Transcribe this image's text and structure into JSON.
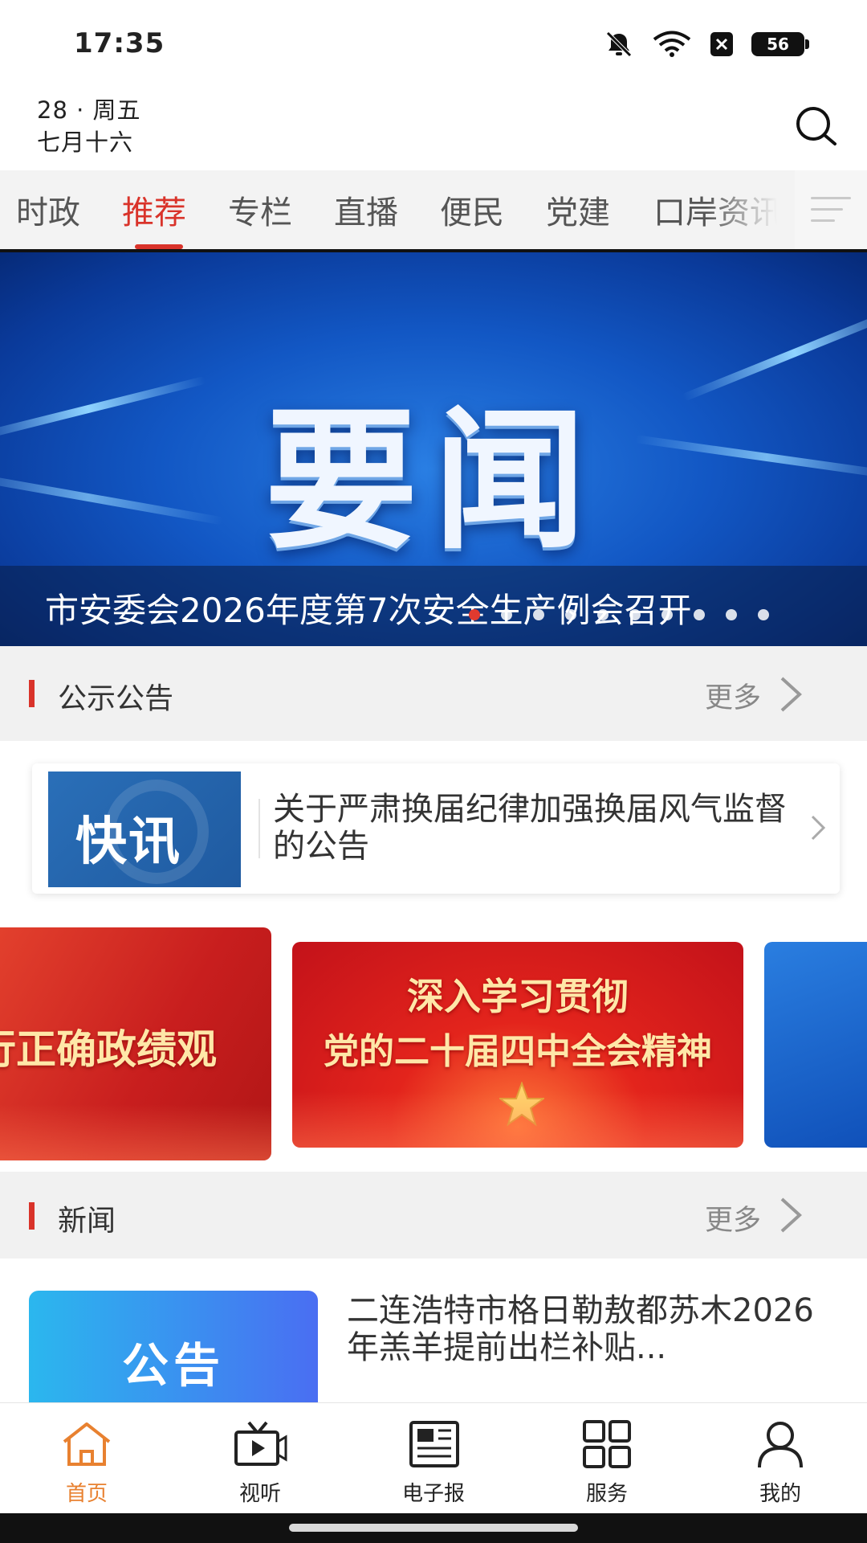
{
  "status_bar": {
    "time": "17:35",
    "battery": "56"
  },
  "header": {
    "day_line": "28 · 周五",
    "lunar_date": "七月十六"
  },
  "tabs": [
    "时政",
    "推荐",
    "专栏",
    "直播",
    "便民",
    "党建",
    "口岸资讯"
  ],
  "active_tab": "推荐",
  "banner": {
    "image_text": "要闻",
    "caption": "市安委会2026年度第7次安全生产例会召开",
    "slide_count": 10,
    "active_slide": 1
  },
  "notices_section": {
    "title": "公示公告",
    "more": "更多"
  },
  "notice_card": {
    "thumb_text": "快讯",
    "title": "关于严肃换届纪律加强换届风气监督的公告"
  },
  "promos": {
    "left_text": "践行正确政绩观",
    "center_line1": "深入学习贯彻",
    "center_line2": "党的二十届四中全会精神"
  },
  "news_section": {
    "title": "新闻",
    "more": "更多"
  },
  "news_item": {
    "thumb_text": "公告",
    "title": "二连浩特市格日勒敖都苏木2026年羔羊提前出栏补贴..."
  },
  "bottom_nav": [
    {
      "label": "首页",
      "icon": "home-icon"
    },
    {
      "label": "视听",
      "icon": "tv-play-icon"
    },
    {
      "label": "电子报",
      "icon": "newspaper-icon"
    },
    {
      "label": "服务",
      "icon": "grid-icon"
    },
    {
      "label": "我的",
      "icon": "user-icon"
    }
  ],
  "colors": {
    "accent": "#d9332a",
    "nav_active": "#e88130",
    "banner_blue": "#1257c4"
  }
}
